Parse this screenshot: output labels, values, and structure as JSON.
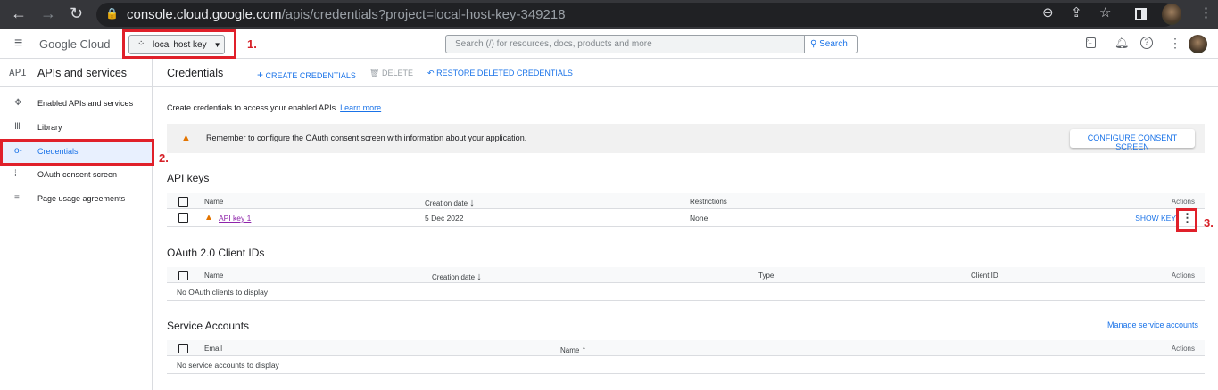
{
  "browser": {
    "url_host": "console.cloud.google.com",
    "url_path": "/apis/credentials?project=local-host-key-349218"
  },
  "header": {
    "brand": "Google Cloud",
    "project": "local host key",
    "search_placeholder": "Search (/) for resources, docs, products and more",
    "search_button": "Search"
  },
  "annotations": {
    "one": "1.",
    "two": "2.",
    "three": "3."
  },
  "sidebar": {
    "title": "APIs and services",
    "logo": "API",
    "items": [
      {
        "label": "Enabled APIs and services"
      },
      {
        "label": "Library"
      },
      {
        "label": "Credentials"
      },
      {
        "label": "OAuth consent screen"
      },
      {
        "label": "Page usage agreements"
      }
    ]
  },
  "toolbar": {
    "title": "Credentials",
    "create": "CREATE CREDENTIALS",
    "delete": "DELETE",
    "restore": "RESTORE DELETED CREDENTIALS"
  },
  "intro": {
    "text": "Create credentials to access your enabled APIs.",
    "link": "Learn more"
  },
  "banner": {
    "text": "Remember to configure the OAuth consent screen with information about your application.",
    "button": "CONFIGURE CONSENT SCREEN"
  },
  "api_keys": {
    "title": "API keys",
    "columns": [
      "Name",
      "Creation date",
      "Restrictions",
      "Actions"
    ],
    "rows": [
      {
        "name": "API key 1",
        "date": "5 Dec 2022",
        "restrictions": "None",
        "action": "SHOW KEY"
      }
    ]
  },
  "oauth": {
    "title": "OAuth 2.0 Client IDs",
    "columns": [
      "Name",
      "Creation date",
      "Type",
      "Client ID",
      "Actions"
    ],
    "empty": "No OAuth clients to display"
  },
  "service": {
    "title": "Service Accounts",
    "manage": "Manage service accounts",
    "columns": [
      "Email",
      "Name",
      "Actions"
    ],
    "empty": "No service accounts to display"
  }
}
